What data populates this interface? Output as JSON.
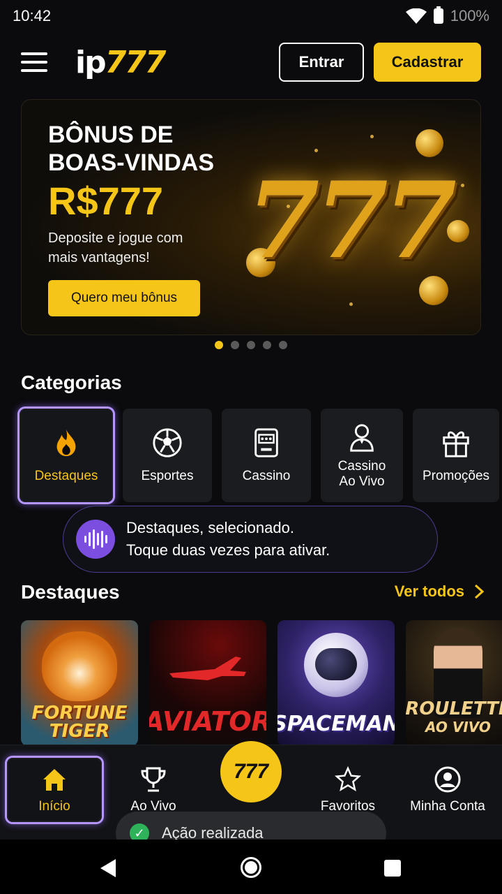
{
  "status_bar": {
    "time": "10:42",
    "battery": "100%"
  },
  "header": {
    "logo_prefix": "ip",
    "logo_suffix": "777",
    "login_label": "Entrar",
    "register_label": "Cadastrar"
  },
  "banner": {
    "title_line1": "BÔNUS DE",
    "title_line2": "BOAS-VINDAS",
    "amount": "R$777",
    "description": "Deposite e jogue com mais vantagens!",
    "cta_label": "Quero meu bônus",
    "art_text": "777",
    "pager": {
      "total": 5,
      "active": 1
    }
  },
  "categories": {
    "title": "Categorias",
    "items": [
      {
        "label": "Destaques",
        "icon": "flame-icon",
        "selected": true
      },
      {
        "label": "Esportes",
        "icon": "soccer-ball-icon",
        "selected": false
      },
      {
        "label": "Cassino",
        "icon": "slot-machine-icon",
        "selected": false
      },
      {
        "label": "Cassino Ao Vivo",
        "icon": "dealer-icon",
        "selected": false
      },
      {
        "label": "Promoções",
        "icon": "gift-icon",
        "selected": false
      }
    ]
  },
  "talkback": {
    "line1": "Destaques, selecionado.",
    "line2": "Toque duas vezes para ativar."
  },
  "featured": {
    "title": "Destaques",
    "see_all_label": "Ver todos",
    "games": [
      {
        "line1": "FORTUNE",
        "line2": "TIGER"
      },
      {
        "line1": "AVIATOR",
        "line2": ""
      },
      {
        "line1": "SPACEMAN",
        "line2": ""
      },
      {
        "line1": "ROULETTE",
        "line2": "AO VIVO"
      }
    ]
  },
  "bottom_nav": {
    "items": [
      {
        "label": "Início",
        "icon": "home-icon",
        "active": true
      },
      {
        "label": "Ao Vivo",
        "icon": "trophy-icon",
        "active": false
      },
      {
        "label": "777",
        "icon": "777-badge",
        "active": false
      },
      {
        "label": "Favoritos",
        "icon": "star-icon",
        "active": false
      },
      {
        "label": "Minha Conta",
        "icon": "account-icon",
        "active": false
      }
    ]
  },
  "toast": {
    "message": "Ação realizada"
  },
  "colors": {
    "accent": "#f5c518",
    "background": "#0b0b0d",
    "focus_ring": "#b596ff",
    "success": "#2fb35a"
  }
}
